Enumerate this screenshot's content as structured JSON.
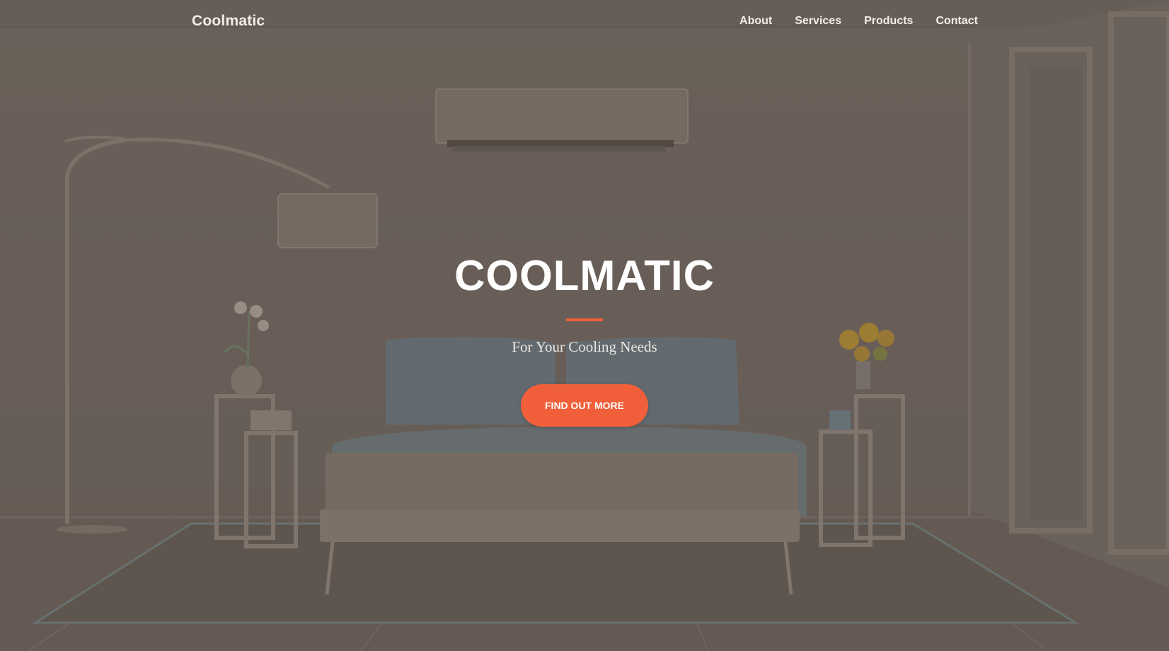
{
  "brand": "Coolmatic",
  "nav": {
    "items": [
      "About",
      "Services",
      "Products",
      "Contact"
    ]
  },
  "hero": {
    "title": "COOLMATIC",
    "subtitle": "For Your Cooling Needs",
    "cta_label": "FIND OUT MORE"
  },
  "colors": {
    "accent": "#f05f3a",
    "overlay": "#6c625b",
    "text": "#ffffff"
  },
  "background_image": {
    "depicts": "bedroom-interior",
    "icons": [
      "air-conditioner",
      "floor-lamp",
      "bed",
      "nightstand",
      "orchid-plant",
      "sunflower-vase",
      "window"
    ]
  }
}
